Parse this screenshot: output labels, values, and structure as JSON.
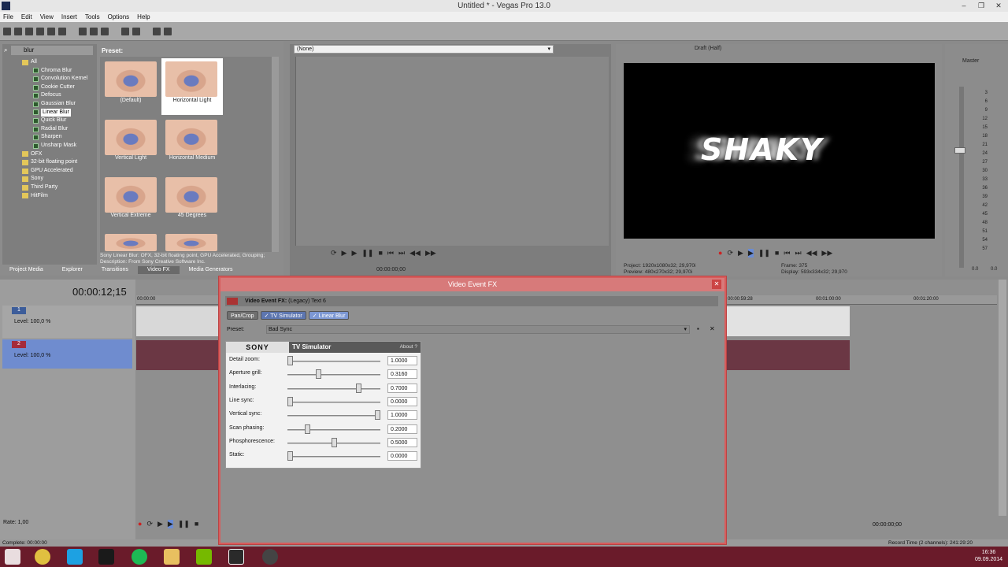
{
  "window": {
    "title": "Untitled * - Vegas Pro 13.0"
  },
  "menu": [
    "File",
    "Edit",
    "View",
    "Insert",
    "Tools",
    "Options",
    "Help"
  ],
  "explorer": {
    "search_value": "blur",
    "preset_label": "Preset:",
    "tree": [
      {
        "label": "All",
        "type": "folder",
        "indent": 1
      },
      {
        "label": "Chroma Blur",
        "type": "fx",
        "indent": 2
      },
      {
        "label": "Convolution Kernel",
        "type": "fx",
        "indent": 2
      },
      {
        "label": "Cookie Cutter",
        "type": "fx",
        "indent": 2
      },
      {
        "label": "Defocus",
        "type": "fx",
        "indent": 2
      },
      {
        "label": "Gaussian Blur",
        "type": "fx",
        "indent": 2
      },
      {
        "label": "Linear Blur",
        "type": "fx",
        "indent": 2,
        "selected": true
      },
      {
        "label": "Quick Blur",
        "type": "fx",
        "indent": 2
      },
      {
        "label": "Radial Blur",
        "type": "fx",
        "indent": 2
      },
      {
        "label": "Sharpen",
        "type": "fx",
        "indent": 2
      },
      {
        "label": "Unsharp Mask",
        "type": "fx",
        "indent": 2
      },
      {
        "label": "OFX",
        "type": "folder",
        "indent": 1
      },
      {
        "label": "32-bit floating point",
        "type": "folder",
        "indent": 1
      },
      {
        "label": "GPU Accelerated",
        "type": "folder",
        "indent": 1
      },
      {
        "label": "Sony",
        "type": "folder",
        "indent": 1
      },
      {
        "label": "Third Party",
        "type": "folder",
        "indent": 1
      },
      {
        "label": "HitFilm",
        "type": "folder",
        "indent": 1
      }
    ],
    "presets": [
      "(Default)",
      "Horizontal Light",
      "Vertical Light",
      "Horizontal Medium",
      "Vertical Extreme",
      "45 Degrees"
    ],
    "description": "Sony Linear Blur: OFX, 32-bit floating point, GPU Accelerated, Grouping; Description: From Sony Creative Software Inc.",
    "tabs": [
      "Project Media",
      "Explorer",
      "Transitions",
      "Video FX",
      "Media Generators"
    ]
  },
  "trimmer": {
    "dropdown": "(None)",
    "timecode": "00:00:00;00"
  },
  "preview": {
    "mode": "Draft (Half)",
    "text": "SHAKY",
    "project_label": "Project:",
    "project": "1920x1080x32; 29,970i",
    "preview_label": "Preview:",
    "preview": "480x270x32; 29,970i",
    "frame_label": "Frame:",
    "frame": "375",
    "display_label": "Display:",
    "display": "593x334x32; 29,970"
  },
  "master": {
    "label": "Master",
    "scale": [
      "3",
      "6",
      "9",
      "12",
      "15",
      "18",
      "21",
      "24",
      "27",
      "30",
      "33",
      "36",
      "39",
      "42",
      "45",
      "48",
      "51",
      "54",
      "57"
    ],
    "val_l": "0.0",
    "val_r": "0.0"
  },
  "timeline": {
    "timecode": "00:00:12;15",
    "ruler_start": "00:00:00",
    "ruler_marks": [
      "00:00:59:28",
      "00:01:00:00",
      "00:01:20:00"
    ],
    "track1": {
      "num": "1",
      "level": "Level: 100,0 %"
    },
    "track2": {
      "num": "2",
      "level": "Level: 100,0 %"
    },
    "rate": "Rate: 1,00",
    "end_timecode": "00:00:00;00"
  },
  "dialog": {
    "title": "Video Event FX",
    "header": "Video Event FX:",
    "header_sub": "(Legacy) Text 6",
    "chain": [
      "Pan/Crop",
      "TV Simulator",
      "Linear Blur"
    ],
    "preset_label": "Preset:",
    "preset_value": "Bad Sync",
    "plugin": {
      "brand": "SONY",
      "name": "TV Simulator",
      "about": "About ?",
      "params": [
        {
          "label": "Detail zoom:",
          "value": "1.0000",
          "pos": 0.0
        },
        {
          "label": "Aperture grill:",
          "value": "0.3160",
          "pos": 0.32
        },
        {
          "label": "Interlacing:",
          "value": "0.7000",
          "pos": 0.78
        },
        {
          "label": "Line sync:",
          "value": "0.0000",
          "pos": 0.0
        },
        {
          "label": "Vertical sync:",
          "value": "1.0000",
          "pos": 1.0
        },
        {
          "label": "Scan phasing:",
          "value": "0.2000",
          "pos": 0.2
        },
        {
          "label": "Phosphorescence:",
          "value": "0.5000",
          "pos": 0.5
        },
        {
          "label": "Static:",
          "value": "0.0000",
          "pos": 0.0
        }
      ]
    }
  },
  "status": {
    "left": "Complete: 00:00:00",
    "right": "Record Time (2 channels): 241:29:20"
  },
  "tray": {
    "time": "16:36",
    "date": "09.09.2014"
  }
}
